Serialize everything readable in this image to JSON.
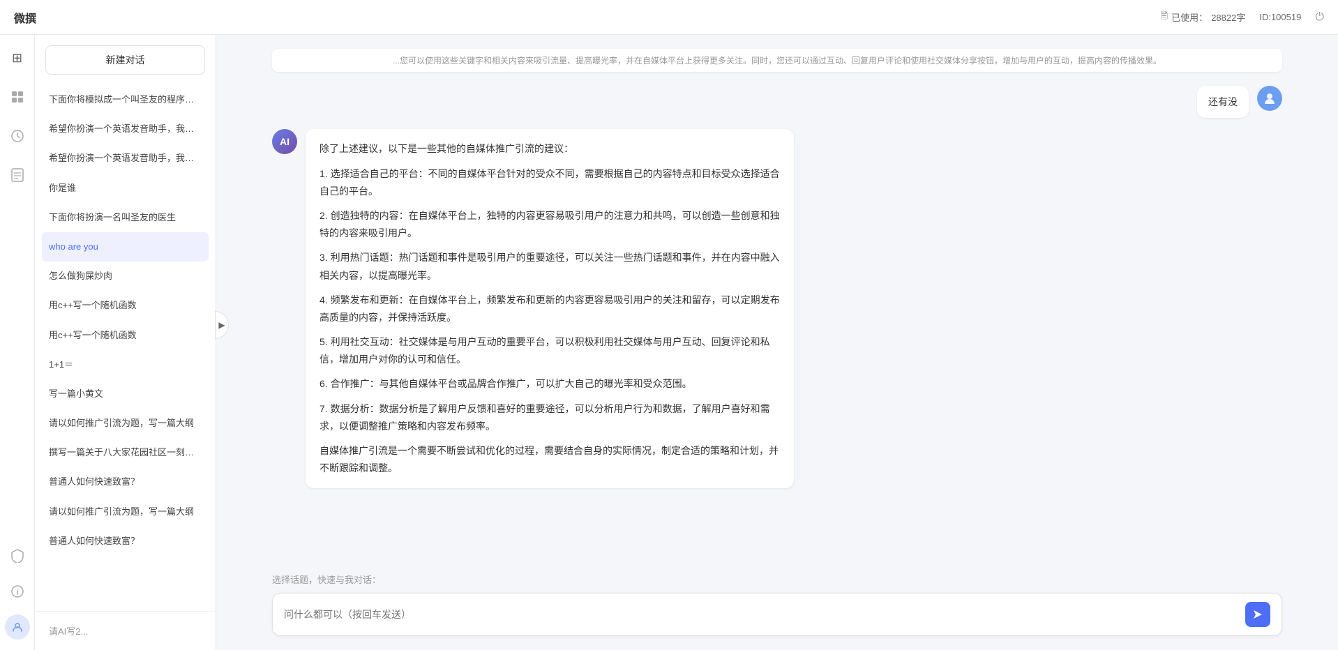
{
  "header": {
    "logo": "微撰",
    "usage_label": "已使用：",
    "usage_value": "28822字",
    "id_label": "ID:100519",
    "power_icon": "⏻"
  },
  "icon_bar": {
    "icons": [
      {
        "name": "home-icon",
        "glyph": "⊞",
        "active": false
      },
      {
        "name": "box-icon",
        "glyph": "◈",
        "active": false
      },
      {
        "name": "clock-icon",
        "glyph": "◷",
        "active": false
      },
      {
        "name": "doc-icon",
        "glyph": "⊟",
        "active": false
      }
    ],
    "bottom_icons": [
      {
        "name": "shield-icon",
        "glyph": "⊕"
      },
      {
        "name": "info-icon",
        "glyph": "ⓘ"
      },
      {
        "name": "user-icon",
        "glyph": "◌"
      }
    ]
  },
  "sidebar": {
    "new_btn_label": "新建对话",
    "items": [
      {
        "id": 1,
        "text": "下面你将模拟成一个叫圣友的程序员，我说...",
        "active": false
      },
      {
        "id": 2,
        "text": "希望你扮演一个英语发音助手，我提供给你...",
        "active": false
      },
      {
        "id": 3,
        "text": "希望你扮演一个英语发音助手，我提供给你...",
        "active": false
      },
      {
        "id": 4,
        "text": "你是谁",
        "active": false
      },
      {
        "id": 5,
        "text": "下面你将扮演一名叫圣友的医生",
        "active": false
      },
      {
        "id": 6,
        "text": "who are you",
        "active": true
      },
      {
        "id": 7,
        "text": "怎么做狗屎炒肉",
        "active": false
      },
      {
        "id": 8,
        "text": "用c++写一个随机函数",
        "active": false
      },
      {
        "id": 9,
        "text": "用c++写一个随机函数",
        "active": false
      },
      {
        "id": 10,
        "text": "1+1＝",
        "active": false
      },
      {
        "id": 11,
        "text": "写一篇小黄文",
        "active": false
      },
      {
        "id": 12,
        "text": "请以如何推广引流为题，写一篇大纲",
        "active": false
      },
      {
        "id": 13,
        "text": "撰写一篇关于八大家花园社区一刻钟便民生...",
        "active": false
      },
      {
        "id": 14,
        "text": "普通人如何快速致富？",
        "active": false
      },
      {
        "id": 15,
        "text": "请以如何推广引流为题，写一篇大纲",
        "active": false
      },
      {
        "id": 16,
        "text": "普通人如何快速致富？",
        "active": false
      }
    ],
    "bottom_items": [
      {
        "text": "请AI写2..."
      }
    ]
  },
  "chat": {
    "truncated_top": "...您可以使用这些关键字和相关内容来吸引流量、提高曝光率，并在自媒体平台上获得更多关注。同时，您还可以通过互动、回复用户评论和使用社交媒体分享按钮，增加与用户的互动，提高内容的传播效果。",
    "user_message": "还有没",
    "ai_response": {
      "paragraphs": [
        "除了上述建议，以下是一些其他的自媒体推广引流的建议：",
        "1. 选择适合自己的平台：不同的自媒体平台针对的受众不同，需要根据自己的内容特点和目标受众选择适合自己的平台。",
        "2. 创造独特的内容：在自媒体平台上，独特的内容更容易吸引用户的注意力和共鸣，可以创造一些创意和独特的内容来吸引用户。",
        "3. 利用热门话题：热门话题和事件是吸引用户的重要途径，可以关注一些热门话题和事件，并在内容中融入相关内容，以提高曝光率。",
        "4. 频繁发布和更新：在自媒体平台上，频繁发布和更新的内容更容易吸引用户的关注和留存，可以定期发布高质量的内容，并保持活跃度。",
        "5. 利用社交互动：社交媒体是与用户互动的重要平台，可以积极利用社交媒体与用户互动、回复评论和私信，增加用户对你的认可和信任。",
        "6. 合作推广：与其他自媒体平台或品牌合作推广，可以扩大自己的曝光率和受众范围。",
        "7. 数据分析：数据分析是了解用户反馈和喜好的重要途径，可以分析用户行为和数据，了解用户喜好和需求，以便调整推广策略和内容发布频率。",
        "自媒体推广引流是一个需要不断尝试和优化的过程，需要结合自身的实际情况，制定合适的策略和计划，并不断跟踪和调整。"
      ]
    }
  },
  "input": {
    "quick_select_label": "选择话题，快速与我对话：",
    "placeholder": "问什么都可以（按回车发送）",
    "send_icon": "➤"
  }
}
